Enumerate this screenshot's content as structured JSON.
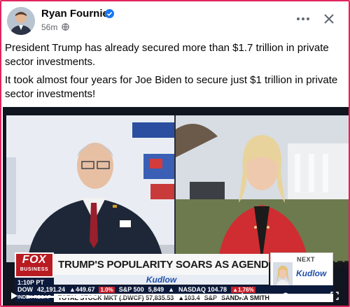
{
  "post": {
    "author": "Ryan Fournier",
    "time": "56m",
    "paragraphs": [
      "President Trump has already secured more than $1.7 trillion in private sector investments.",
      "It took almost four years for Joe Biden to secure just $1 trillion in private sector investments!"
    ]
  },
  "video": {
    "network_logo": "FOX",
    "network_sub": "BUSINESS",
    "headline": "TRUMP'S POPULARITY SOARS AS AGENDA TAKES SHAPE",
    "time": "1:10P PT",
    "show": "Kudlow",
    "next_label": "NEXT",
    "next_show": "Kudlow",
    "ticker_top": [
      "DOW",
      "42,191.24",
      "▲449.67",
      "1.0%",
      "S&P 500",
      "5,849",
      "▲",
      "NASDAQ 104.78",
      "▲1.76%"
    ],
    "ticker_bottom_tag": "INDEX RECAP",
    "ticker_bottom": [
      "TOTAL STOCK MKT (.DWCF) 57,835.53",
      "▲103.4",
      "S&P",
      "SANDRA SMITH"
    ],
    "progress_fraction": 0.35
  },
  "icons": [
    "verified-badge-icon",
    "globe-icon",
    "more-icon",
    "close-icon",
    "play-icon",
    "volume-icon",
    "settings-icon",
    "fullscreen-icon"
  ],
  "colors": {
    "accent": "#1877f2",
    "fox_red": "#b81c22",
    "border": "#e0245e"
  }
}
